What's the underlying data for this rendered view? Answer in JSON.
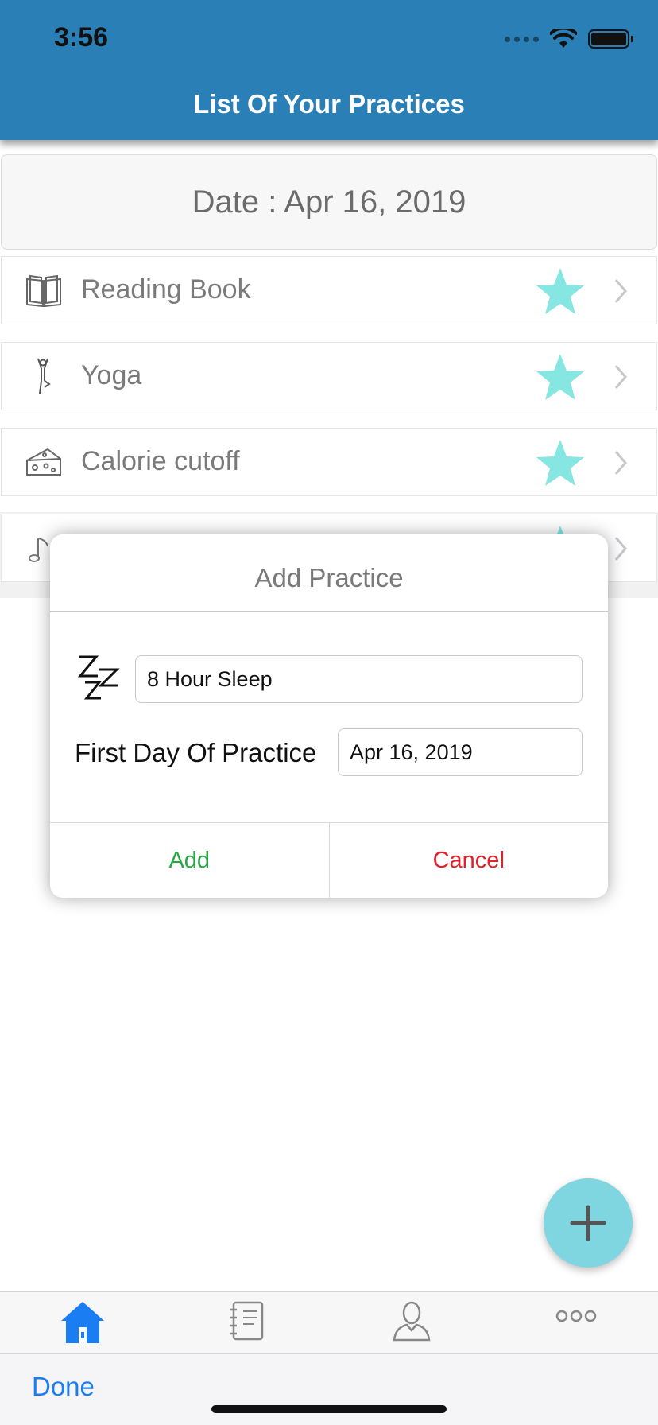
{
  "status_bar": {
    "time": "3:56"
  },
  "header": {
    "title": "List Of Your Practices"
  },
  "date_box": {
    "text": "Date : Apr 16, 2019"
  },
  "practices": [
    {
      "label": "Reading Book",
      "icon": "book-icon"
    },
    {
      "label": "Yoga",
      "icon": "yoga-icon"
    },
    {
      "label": "Calorie cutoff",
      "icon": "cheese-icon"
    },
    {
      "label": "",
      "icon": "music-note-icon"
    }
  ],
  "dialog": {
    "title": "Add Practice",
    "name_value": "8 Hour Sleep",
    "first_day_label": "First Day Of Practice",
    "date_value": "Apr 16, 2019",
    "add_label": "Add",
    "cancel_label": "Cancel"
  },
  "tabbar": {
    "items": [
      {
        "icon": "home-icon",
        "active": true
      },
      {
        "icon": "notebook-icon",
        "active": false
      },
      {
        "icon": "profile-icon",
        "active": false
      },
      {
        "icon": "more-icon",
        "active": false
      }
    ]
  },
  "accessory": {
    "done_label": "Done"
  },
  "colors": {
    "header": "#2a7fb7",
    "star": "#86e6e1",
    "fab": "#7fd6e1",
    "add": "#27a844",
    "cancel": "#e2222b",
    "active_tab": "#1a7ef2"
  }
}
